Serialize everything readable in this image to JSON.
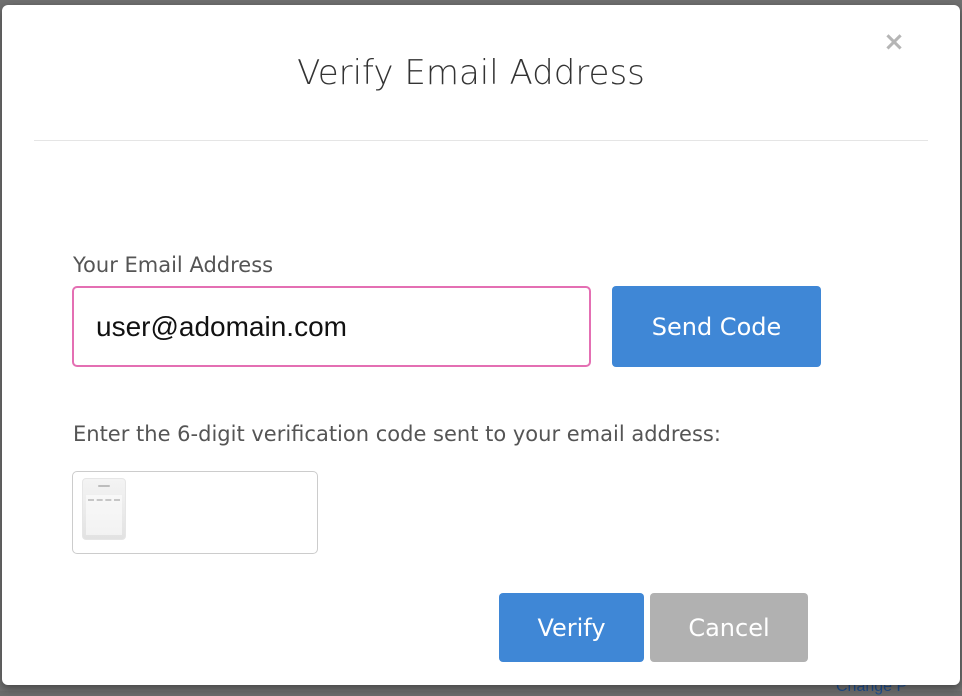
{
  "modal": {
    "title": "Verify Email Address",
    "close_label": "×"
  },
  "email": {
    "label": "Your Email Address",
    "value": "user@adomain.com",
    "send_label": "Send Code"
  },
  "code": {
    "instructions": "Enter the 6-digit verification code sent to your email address:",
    "value": ""
  },
  "actions": {
    "verify_label": "Verify",
    "cancel_label": "Cancel"
  },
  "background": {
    "link_text": "Change P"
  },
  "colors": {
    "primary": "#3f87d6",
    "secondary": "#b1b1b1",
    "focus_border": "#e46fb3"
  }
}
